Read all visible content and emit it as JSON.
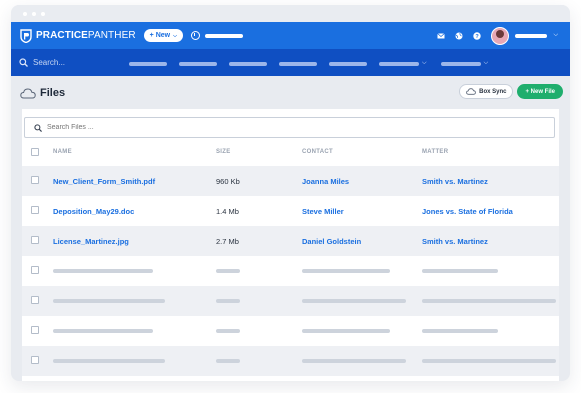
{
  "app": {
    "brand_bold": "PRACTICE",
    "brand_thin": "PANTHER",
    "new_button": "+ New"
  },
  "navbar": {
    "search_placeholder": "Search..."
  },
  "page": {
    "title": "Files",
    "box_sync_label": "Box Sync",
    "new_file_label": "+ New File"
  },
  "files_search": {
    "placeholder": "Search Files ..."
  },
  "table": {
    "columns": [
      "NAME",
      "SIZE",
      "CONTACT",
      "MATTER"
    ],
    "rows": [
      {
        "name": "New_Client_Form_Smith.pdf",
        "size": "960 Kb",
        "contact": "Joanna Miles",
        "matter": "Smith vs. Martinez"
      },
      {
        "name": "Deposition_May29.doc",
        "size": "1.4 Mb",
        "contact": "Steve Miller",
        "matter": "Jones vs. State of Florida"
      },
      {
        "name": "License_Martinez.jpg",
        "size": "2.7 Mb",
        "contact": "Daniel Goldstein",
        "matter": "Smith vs. Martinez"
      }
    ]
  },
  "colors": {
    "topbar": "#1a6fe0",
    "navbar": "#0f4fc2",
    "link": "#1a6fe0",
    "new_file_button": "#1fae6d"
  }
}
